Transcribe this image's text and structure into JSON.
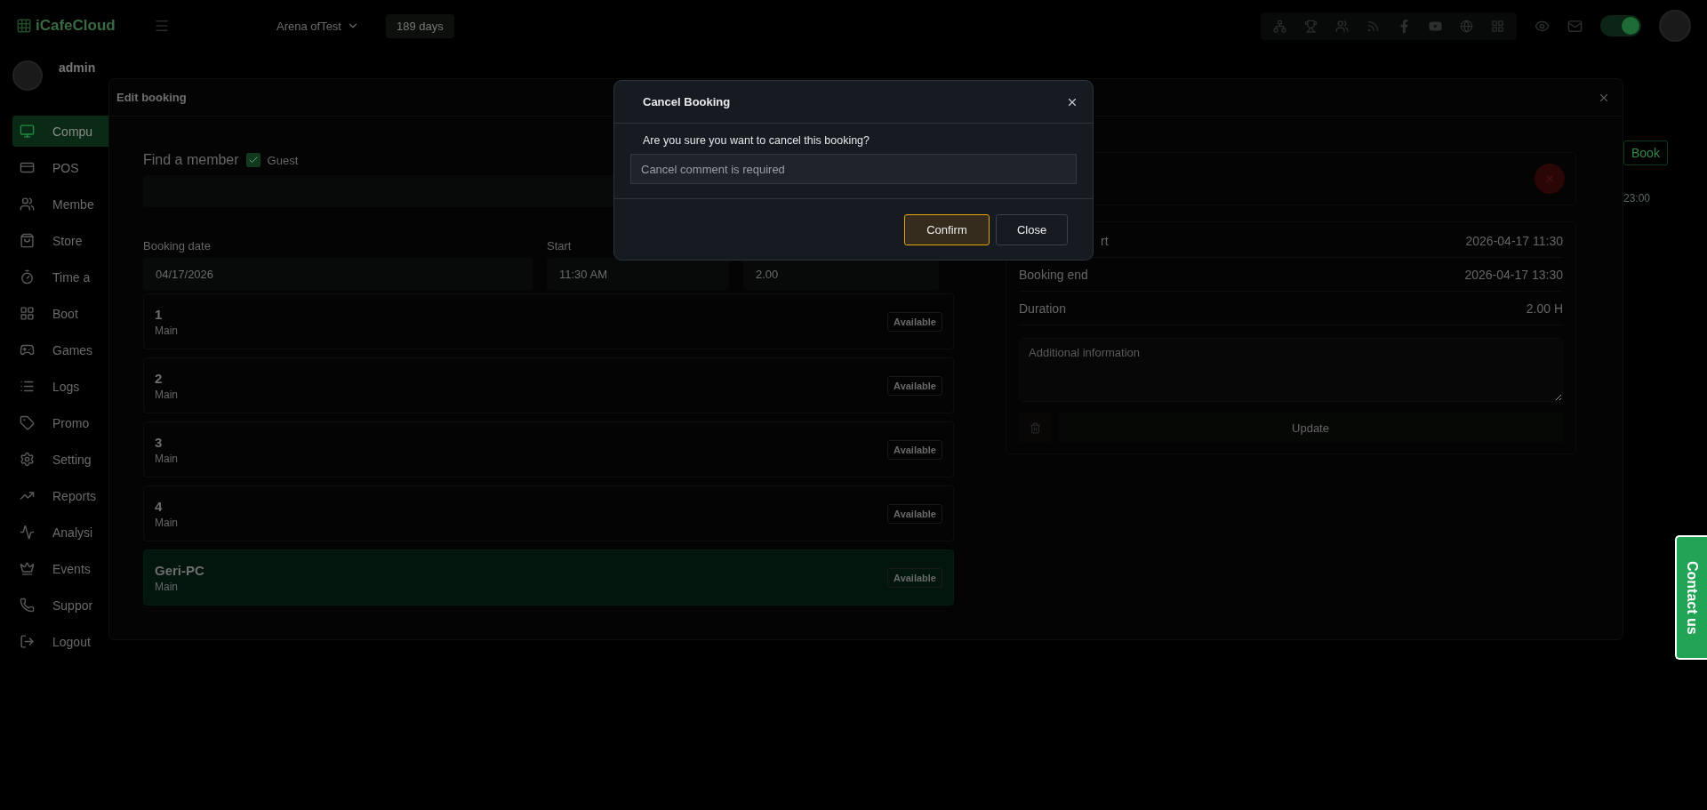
{
  "topbar": {
    "brand": "iCafeCloud",
    "cafe_select": "Arena ofTest",
    "days_badge": "189 days",
    "toggle_on": true
  },
  "sidebar": {
    "user": "admin",
    "items": [
      {
        "label": "Compu",
        "selected": true
      },
      {
        "label": "POS",
        "selected": false
      },
      {
        "label": "Membe",
        "selected": false
      },
      {
        "label": "Store",
        "selected": false
      },
      {
        "label": "Time a",
        "selected": false
      },
      {
        "label": "Boot",
        "selected": false
      },
      {
        "label": "Games",
        "selected": false
      },
      {
        "label": "Logs",
        "selected": false
      },
      {
        "label": "Promo",
        "selected": false
      },
      {
        "label": "Setting",
        "selected": false
      },
      {
        "label": "Reports",
        "selected": false
      },
      {
        "label": "Analysi",
        "selected": false
      },
      {
        "label": "Events",
        "selected": false
      },
      {
        "label": "Suppor",
        "selected": false
      },
      {
        "label": "Logout",
        "selected": false
      }
    ]
  },
  "page": {
    "book_button": "Book",
    "time_label": "23:00"
  },
  "edit_booking": {
    "title": "Edit booking",
    "member_label": "Find a member",
    "guest": {
      "label": "Guest",
      "checked": true
    },
    "date_label": "Booking date",
    "date_value": "04/17/2026",
    "start_label": "Start",
    "start_value": "11:30 AM",
    "hours_value": "2.00",
    "pcs": [
      {
        "name": "1",
        "group": "Main",
        "status": "Available",
        "selected": false
      },
      {
        "name": "2",
        "group": "Main",
        "status": "Available",
        "selected": false
      },
      {
        "name": "3",
        "group": "Main",
        "status": "Available",
        "selected": false
      },
      {
        "name": "4",
        "group": "Main",
        "status": "Available",
        "selected": false
      },
      {
        "name": "Geri-PC",
        "group": "Main",
        "status": "Available",
        "selected": true
      }
    ],
    "details": {
      "rows": [
        {
          "label": "rt",
          "value": "2026-04-17 11:30"
        },
        {
          "label": "Booking end",
          "value": "2026-04-17 13:30"
        },
        {
          "label": "Duration",
          "value": "2.00 H"
        }
      ],
      "info_placeholder": "Additional information",
      "update_button": "Update"
    }
  },
  "cancel_dialog": {
    "title": "Cancel Booking",
    "message": "Are you sure you want to cancel this booking?",
    "comment_placeholder": "Cancel comment is required",
    "confirm": "Confirm",
    "close": "Close"
  },
  "contact_tab": "Contact us"
}
